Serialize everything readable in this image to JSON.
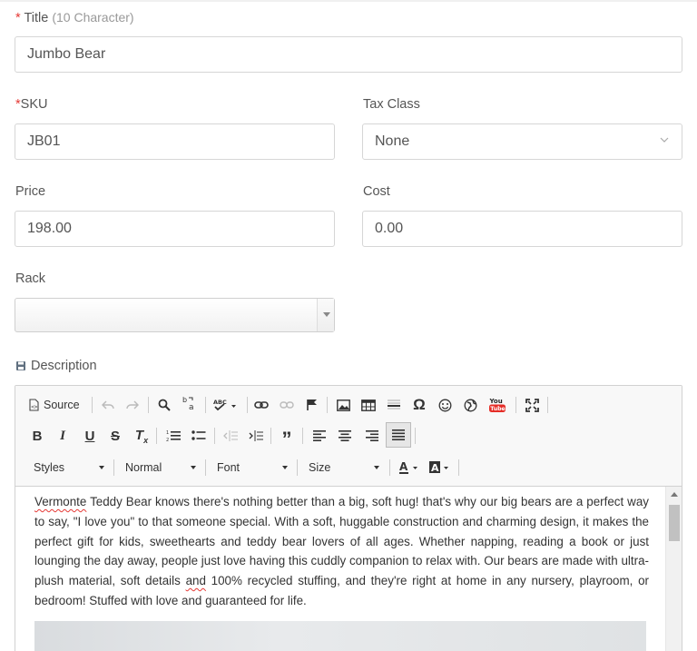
{
  "title_field": {
    "required_mark": "*",
    "label": "Title",
    "hint": "(10 Character)",
    "value": "Jumbo Bear"
  },
  "sku_field": {
    "required_mark": "*",
    "label": "SKU",
    "value": "JB01"
  },
  "tax_class_field": {
    "label": "Tax Class",
    "value": "None"
  },
  "price_field": {
    "label": "Price",
    "value": "198.00"
  },
  "cost_field": {
    "label": "Cost",
    "value": "0.00"
  },
  "rack_field": {
    "label": "Rack",
    "value": ""
  },
  "description": {
    "label": "Description",
    "toolbar": {
      "source_label": "Source",
      "styles_label": "Styles",
      "format_label": "Normal",
      "font_label": "Font",
      "size_label": "Size"
    },
    "content": {
      "misspelled_1": "Vermonte",
      "text_1": " Teddy Bear knows there's nothing better than a big, soft hug! that's why our big bears are a perfect way to say, \"I love you\" to that someone special. With a soft, huggable construction and charming design, it makes the perfect gift for kids, sweethearts and teddy bear lovers of all ages. Whether napping, reading a book or just lounging the day away, people just love having this cuddly companion to relax with. Our bears are made with ultra-plush material, soft details ",
      "misspelled_2": "and",
      "text_2": " 100% recycled stuffing, and they're right at home in any nursery, playroom, or bedroom! Stuffed with love and guaranteed for life."
    }
  },
  "colors": {
    "required": "#e53935",
    "border": "#d6d6d6",
    "toolbar_bg": "#f8f8f8"
  }
}
